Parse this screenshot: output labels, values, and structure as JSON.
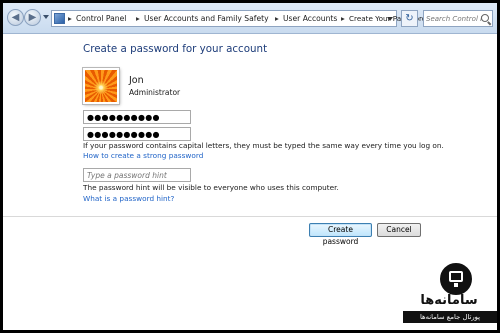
{
  "addressbar": {
    "breadcrumbs": [
      "Control Panel",
      "User Accounts and Family Safety",
      "User Accounts",
      "Create Your Password"
    ],
    "search_placeholder": "Search Control P..."
  },
  "main": {
    "title": "Create a password for your account",
    "user": {
      "name": "Jon",
      "role": "Administrator"
    },
    "password_value": "●●●●●●●●●●",
    "confirm_value": "●●●●●●●●●●",
    "caps_note": "If your password contains capital letters, they must be typed the same way every time you log on.",
    "strong_link": "How to create a strong password",
    "hint_placeholder": "Type a password hint",
    "hint_note": "The password hint will be visible to everyone who uses this computer.",
    "hint_link": "What is a password hint?",
    "create_button": "Create password",
    "cancel_button": "Cancel"
  },
  "watermark": {
    "title": "سامانه‌ها",
    "subtitle": "پورتال جامع سامانه‌ها"
  },
  "icons": [
    "back-arrow-icon",
    "forward-arrow-icon",
    "control-panel-icon",
    "refresh-icon",
    "search-icon",
    "user-flower-avatar",
    "watermark-monitor-icon"
  ]
}
